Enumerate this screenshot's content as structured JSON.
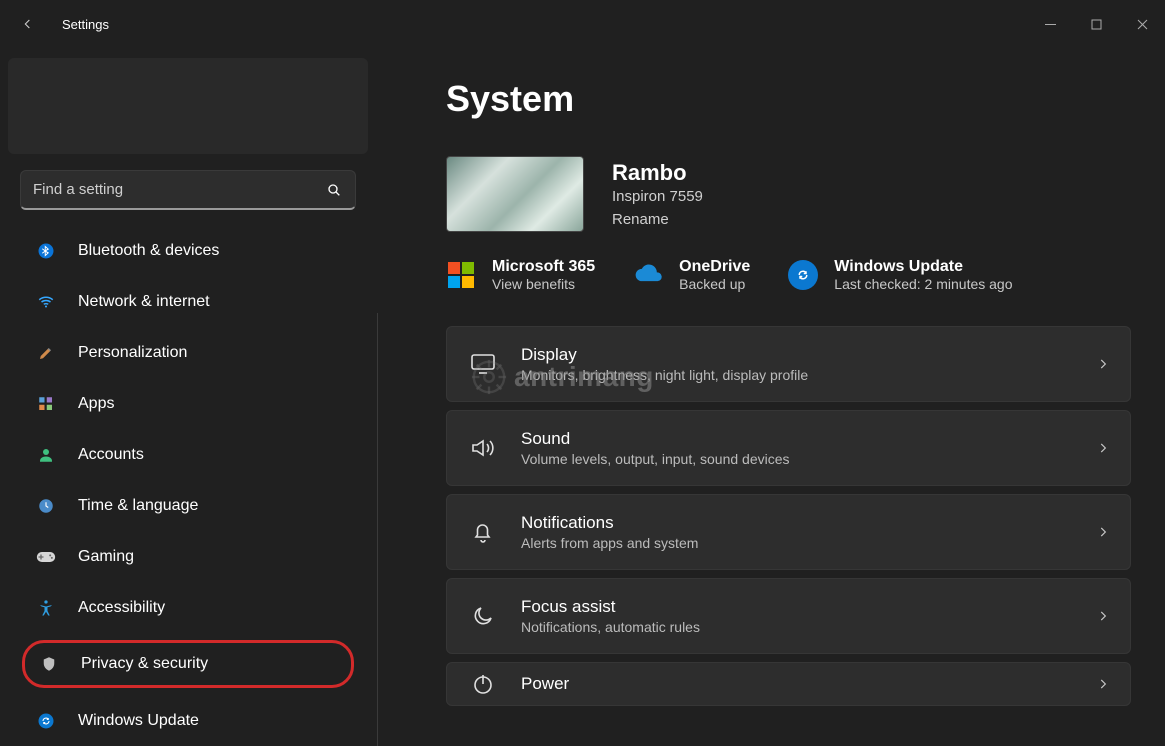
{
  "app_title": "Settings",
  "search": {
    "placeholder": "Find a setting"
  },
  "nav": [
    {
      "id": "bluetooth",
      "label": "Bluetooth & devices"
    },
    {
      "id": "network",
      "label": "Network & internet"
    },
    {
      "id": "personalization",
      "label": "Personalization"
    },
    {
      "id": "apps",
      "label": "Apps"
    },
    {
      "id": "accounts",
      "label": "Accounts"
    },
    {
      "id": "time",
      "label": "Time & language"
    },
    {
      "id": "gaming",
      "label": "Gaming"
    },
    {
      "id": "accessibility",
      "label": "Accessibility"
    },
    {
      "id": "privacy",
      "label": "Privacy & security",
      "highlighted": true
    },
    {
      "id": "update",
      "label": "Windows Update"
    }
  ],
  "page": {
    "title": "System",
    "device": {
      "name": "Rambo",
      "model": "Inspiron 7559",
      "rename": "Rename"
    },
    "tiles": [
      {
        "id": "ms365",
        "title": "Microsoft 365",
        "sub": "View benefits"
      },
      {
        "id": "onedrive",
        "title": "OneDrive",
        "sub": "Backed up"
      },
      {
        "id": "winupdate",
        "title": "Windows Update",
        "sub": "Last checked: 2 minutes ago"
      }
    ],
    "cards": [
      {
        "id": "display",
        "title": "Display",
        "sub": "Monitors, brightness, night light, display profile"
      },
      {
        "id": "sound",
        "title": "Sound",
        "sub": "Volume levels, output, input, sound devices"
      },
      {
        "id": "notifications",
        "title": "Notifications",
        "sub": "Alerts from apps and system"
      },
      {
        "id": "focus",
        "title": "Focus assist",
        "sub": "Notifications, automatic rules"
      },
      {
        "id": "power",
        "title": "Power",
        "sub": ""
      }
    ]
  },
  "watermark": "antrimang"
}
